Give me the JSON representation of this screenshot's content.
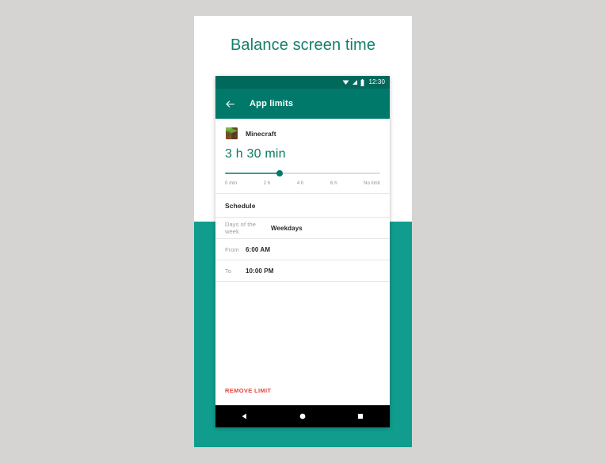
{
  "slide": {
    "title": "Balance screen time",
    "background_color": "#d6d4d3",
    "card_color": "#ffffff",
    "panel_color": "#119d8d",
    "title_color": "#15806c"
  },
  "phone": {
    "status_bar": {
      "time": "12:30",
      "icons": [
        "wifi-icon",
        "signal-icon",
        "battery-icon"
      ],
      "background_color": "#00695c"
    },
    "app_bar": {
      "title": "App limits",
      "back_icon": "back-arrow-icon",
      "background_color": "#00796b"
    },
    "app": {
      "name": "Minecraft",
      "icon": "minecraft-grass-block-icon"
    },
    "limit": {
      "value": "3 h 30 min",
      "value_color": "#0b7b60",
      "slider": {
        "position_percent": 35,
        "fill_color": "#3f9e8d",
        "thumb_color": "#00796b",
        "track_color": "#dedede",
        "ticks": [
          "0 min",
          "2 h",
          "4 h",
          "6 h",
          "No limit"
        ]
      }
    },
    "schedule": {
      "title": "Schedule",
      "rows": [
        {
          "label": "Days of the week",
          "value": "Weekdays"
        },
        {
          "label": "From",
          "value": "6:00 AM"
        },
        {
          "label": "To",
          "value": "10:00 PM"
        }
      ]
    },
    "actions": {
      "remove_limit": "REMOVE LIMIT",
      "remove_limit_color": "#e8433f"
    },
    "nav_bar": {
      "buttons": [
        "back-triangle-icon",
        "home-circle-icon",
        "recents-square-icon"
      ],
      "background_color": "#000000"
    }
  }
}
